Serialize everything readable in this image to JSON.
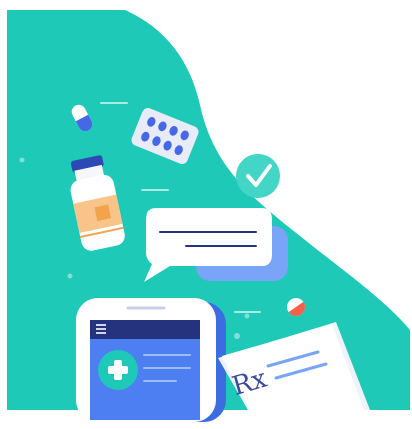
{
  "illustration": {
    "rx_symbol": "Rx",
    "icons": [
      "capsule-icon",
      "pill-blister-icon",
      "medicine-bottle-icon",
      "checkmark-badge-icon",
      "chat-bubble-icon",
      "round-pill-icon",
      "smartphone-icon",
      "medical-cross-icon",
      "prescription-paper-icon",
      "hamburger-menu-icon"
    ]
  },
  "colors": {
    "background_blob": "#1ec9b7",
    "phone_frame": "#ffffff",
    "phone_screen": "#4d7ef2",
    "phone_header": "#25337f",
    "bottle_cap": "#2c49b5",
    "bottle_label": "#f2a44c",
    "check_badge": "#43d6c6",
    "chat_back": "#7aa4f7",
    "pill_red": "#f2614a",
    "capsule_blue": "#4668e6",
    "rx_ink": "#3a4a9e"
  }
}
